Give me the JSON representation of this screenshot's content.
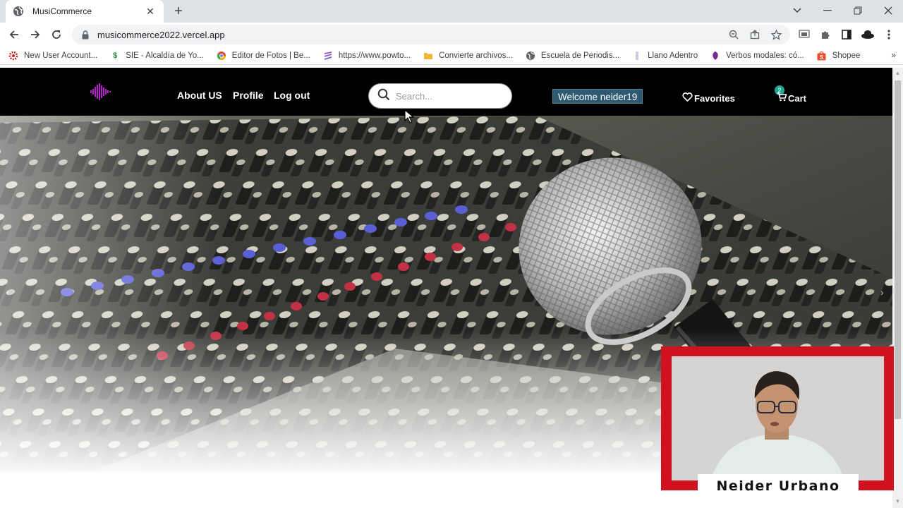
{
  "browser": {
    "tab_title": "MusiCommerce",
    "tab_close": "✕",
    "new_tab": "+",
    "url": "musicommerce2022.vercel.app",
    "bookmarks": [
      {
        "label": "New User Account...",
        "icon": "gear-red-icon"
      },
      {
        "label": "SIE - Alcaldía de Yo...",
        "icon": "dollar-icon"
      },
      {
        "label": "Editor de Fotos | Be...",
        "icon": "chrome-icon"
      },
      {
        "label": "https://www.powto...",
        "icon": "powtoon-icon"
      },
      {
        "label": "Convierte archivos...",
        "icon": "folder-icon"
      },
      {
        "label": "Escuela de Periodis...",
        "icon": "globe-icon"
      },
      {
        "label": "Llano Adentro",
        "icon": "figure-icon"
      },
      {
        "label": "Verbos modales: có...",
        "icon": "purple-icon"
      },
      {
        "label": "Shopee",
        "icon": "shopee-icon"
      }
    ],
    "bookmarks_more": "»"
  },
  "site": {
    "nav_links": [
      "About US",
      "Profile",
      "Log out"
    ],
    "search_placeholder": "Search...",
    "welcome": "Welcome neider19",
    "favorites": "Favorites",
    "cart": "Cart",
    "cart_count": "2"
  },
  "overlay": {
    "presenter_name": "Neider Urbano"
  },
  "colors": {
    "nav_bg": "#000000",
    "welcome_bg": "#2e5a72",
    "cam_frame": "#d0111e",
    "cart_badge": "#1fa88e"
  }
}
